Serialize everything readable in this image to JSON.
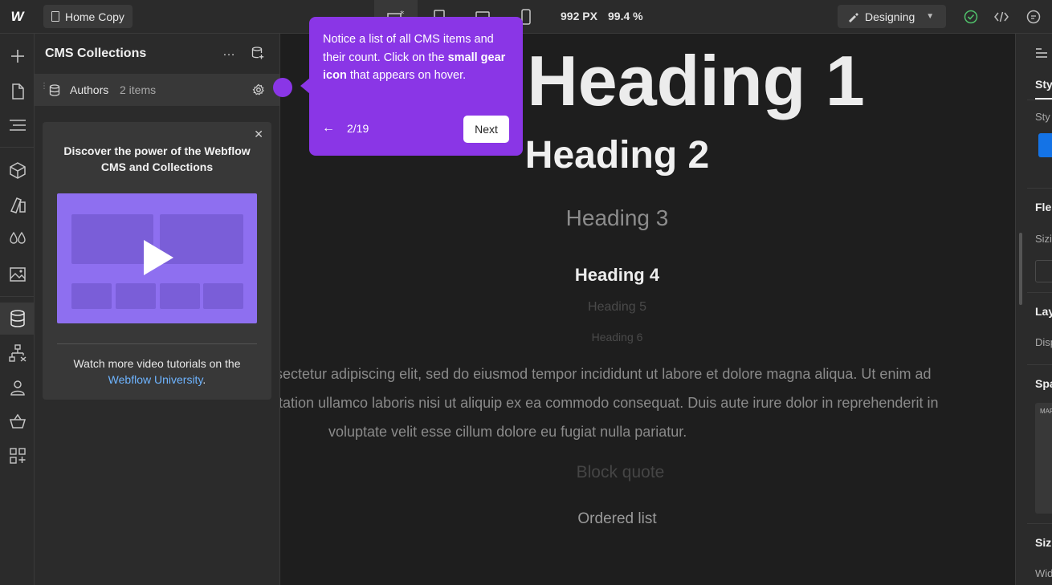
{
  "topbar": {
    "logo": "W",
    "page_name": "Home Copy",
    "more": "…",
    "width_readout": "992 PX",
    "zoom_readout": "99.4 %",
    "mode_label": "Designing"
  },
  "cms_panel": {
    "title": "CMS Collections",
    "more": "…",
    "collection": {
      "name": "Authors",
      "count": "2 items"
    },
    "promo": {
      "headline": "Discover the power of the Webflow CMS and Collections",
      "footer_text": "Watch more video tutorials on the",
      "footer_link": "Webflow University",
      "footer_end": "."
    }
  },
  "canvas": {
    "h1": "Heading 1",
    "h2": "Heading 2",
    "h3": "Heading 3",
    "h4": "Heading 4",
    "h5": "Heading 5",
    "h6": "Heading 6",
    "paragraph_line1": "sectetur adipiscing elit, sed do eiusmod tempor incididunt ut labore et dolore magna aliqua. Ut enim ad",
    "paragraph_line2": "itation ullamco laboris nisi ut aliquip ex ea commodo consequat. Duis aute irure dolor in reprehenderit in",
    "paragraph_line3": "voluptate velit esse cillum dolore eu fugiat nulla pariatur.",
    "block_quote": "Block quote",
    "ordered_list": "Ordered list"
  },
  "right_panel": {
    "tab_style": "Sty",
    "style_label": "Sty",
    "flex_label": "Fle",
    "sizing_label": "Sizi",
    "layout_label": "Lay",
    "display_label": "Disp",
    "spacing_label": "Spa",
    "margin_label": "MAR",
    "size_label": "Siz",
    "width_label": "Wid"
  },
  "tour": {
    "text_before": "Notice a list of all CMS items and their count. Click on the ",
    "text_bold": "small gear icon",
    "text_after": " that appears on hover.",
    "step": "2/19",
    "next_label": "Next"
  },
  "colors": {
    "tour_purple": "#8a36e6",
    "link_blue": "#6eb4ff",
    "accent_blue": "#1473e6"
  }
}
